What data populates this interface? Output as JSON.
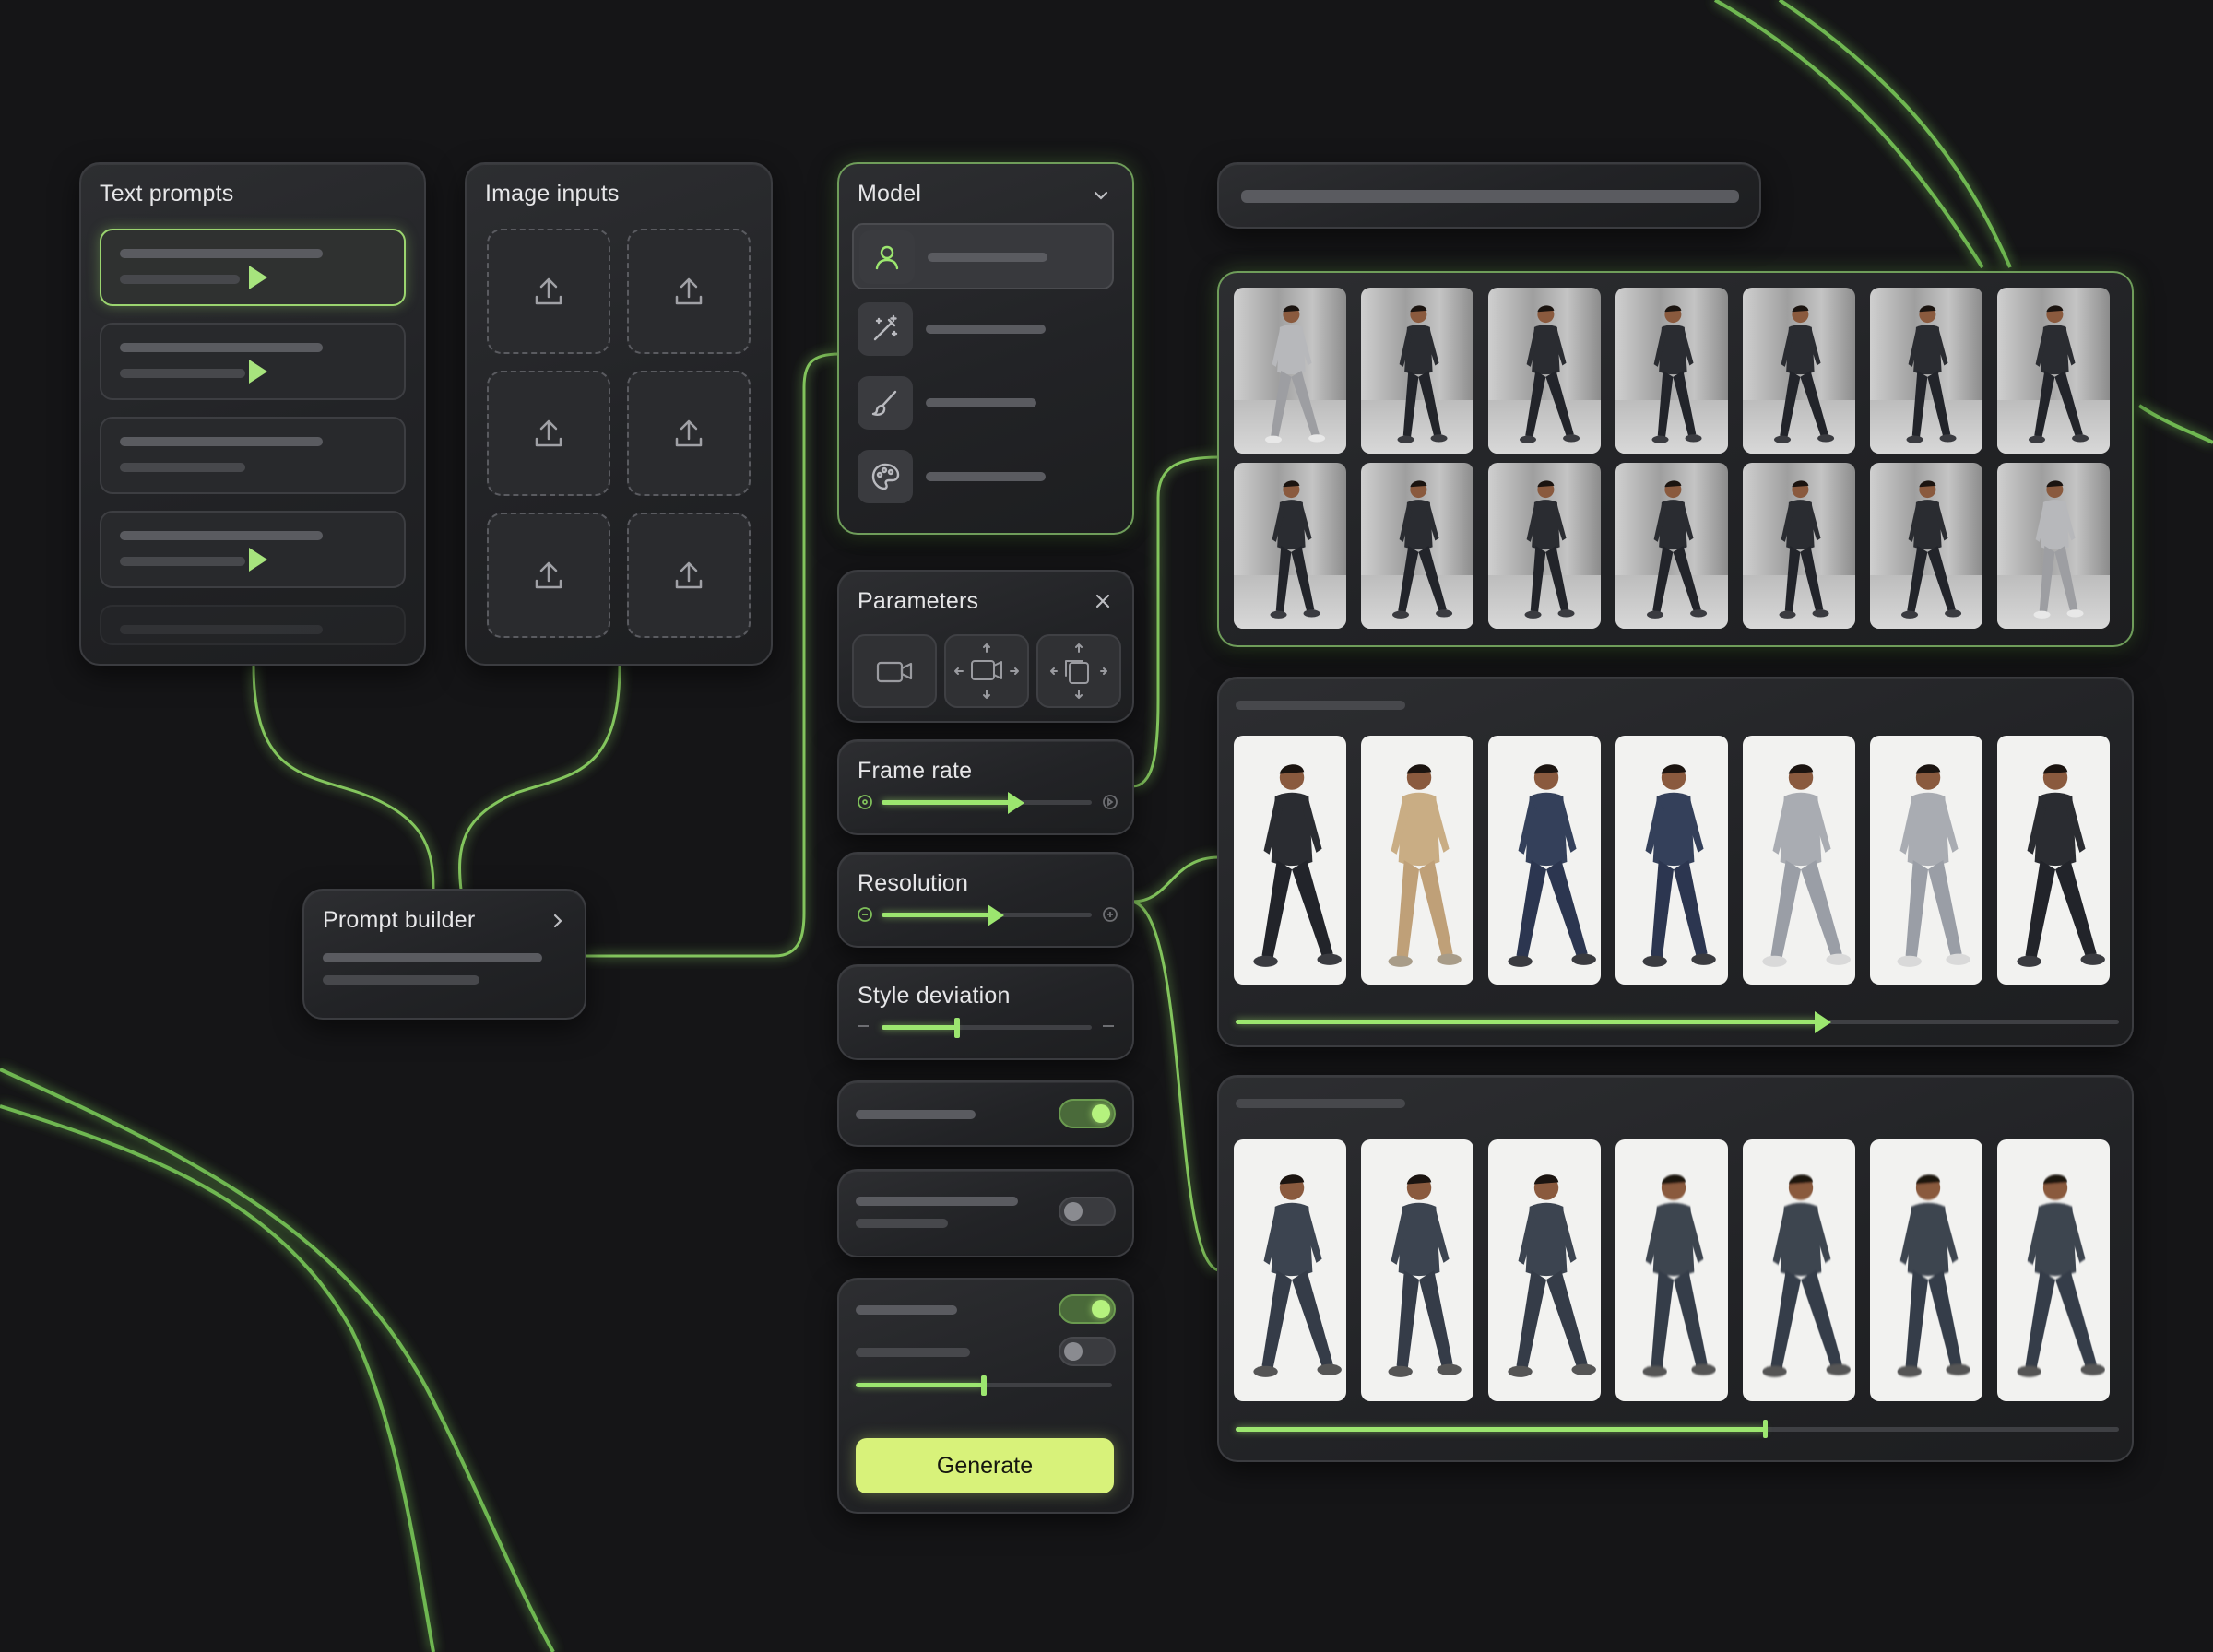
{
  "panels": {
    "text_prompts": {
      "title": "Text prompts"
    },
    "image_inputs": {
      "title": "Image inputs"
    },
    "model": {
      "title": "Model",
      "items": [
        "user-icon",
        "magic-wand-icon",
        "brush-icon",
        "palette-icon"
      ]
    },
    "parameters": {
      "title": "Parameters",
      "buttons": [
        "camera-icon",
        "camera-move-icon",
        "camera-rotate-icon"
      ]
    },
    "frame_rate": {
      "label": "Frame rate",
      "value": 0.62
    },
    "resolution": {
      "label": "Resolution",
      "value": 0.52
    },
    "style_deviation": {
      "label": "Style deviation",
      "value": 0.36
    },
    "toggles": {
      "toggle_1": true,
      "toggle_2": false,
      "toggle_3": true,
      "toggle_4": false,
      "slider_value": 0.5
    },
    "prompt_builder": {
      "title": "Prompt builder"
    },
    "generate_button": {
      "label": "Generate"
    }
  },
  "outputs": {
    "strip_2_progress": 0.66,
    "strip_3_progress": 0.6
  },
  "colors": {
    "accent": "#9ce66f",
    "button": "#d8f27a",
    "background": "#151517"
  }
}
